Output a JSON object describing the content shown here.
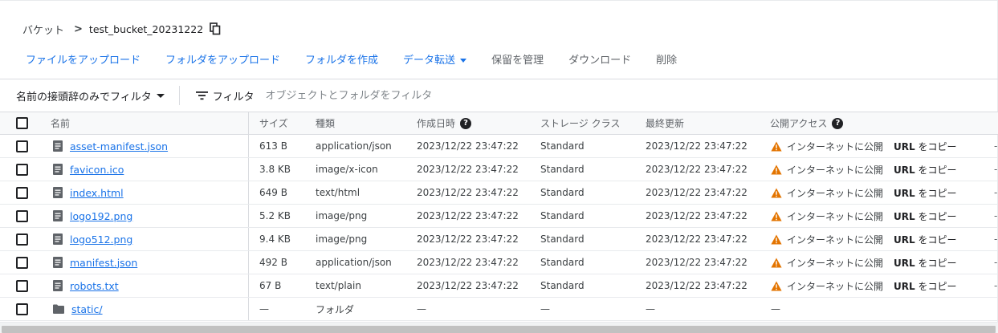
{
  "breadcrumb": {
    "root": "バケット",
    "separator": ">",
    "current": "test_bucket_20231222"
  },
  "toolbar": {
    "upload_files": "ファイルをアップロード",
    "upload_folder": "フォルダをアップロード",
    "create_folder": "フォルダを作成",
    "transfer_data": "データ転送",
    "manage_holds": "保留を管理",
    "download": "ダウンロード",
    "delete": "削除"
  },
  "filter_bar": {
    "prefix_filter": "名前の接頭辞のみでフィルタ",
    "filter_label": "フィルタ",
    "filter_placeholder": "オブジェクトとフォルダをフィルタ"
  },
  "columns": {
    "name": "名前",
    "size": "サイズ",
    "type": "種類",
    "created": "作成日時",
    "storage_class": "ストレージ クラス",
    "updated": "最終更新",
    "public_access": "公開アクセス"
  },
  "rows": [
    {
      "name": "asset-manifest.json",
      "size": "613 B",
      "type": "application/json",
      "created": "2023/12/22 23:47:22",
      "storage_class": "Standard",
      "updated": "2023/12/22 23:47:22",
      "public_access": "インターネットに公開",
      "copy_url_bold": "URL",
      "copy_url_rest": " をコピー",
      "icon": "file-icon",
      "trail": "-"
    },
    {
      "name": "favicon.ico",
      "size": "3.8 KB",
      "type": "image/x-icon",
      "created": "2023/12/22 23:47:22",
      "storage_class": "Standard",
      "updated": "2023/12/22 23:47:22",
      "public_access": "インターネットに公開",
      "copy_url_bold": "URL",
      "copy_url_rest": " をコピー",
      "icon": "file-icon",
      "trail": "-"
    },
    {
      "name": "index.html",
      "size": "649 B",
      "type": "text/html",
      "created": "2023/12/22 23:47:22",
      "storage_class": "Standard",
      "updated": "2023/12/22 23:47:22",
      "public_access": "インターネットに公開",
      "copy_url_bold": "URL",
      "copy_url_rest": " をコピー",
      "icon": "file-icon",
      "trail": "-"
    },
    {
      "name": "logo192.png",
      "size": "5.2 KB",
      "type": "image/png",
      "created": "2023/12/22 23:47:22",
      "storage_class": "Standard",
      "updated": "2023/12/22 23:47:22",
      "public_access": "インターネットに公開",
      "copy_url_bold": "URL",
      "copy_url_rest": " をコピー",
      "icon": "file-icon",
      "trail": "-"
    },
    {
      "name": "logo512.png",
      "size": "9.4 KB",
      "type": "image/png",
      "created": "2023/12/22 23:47:22",
      "storage_class": "Standard",
      "updated": "2023/12/22 23:47:22",
      "public_access": "インターネットに公開",
      "copy_url_bold": "URL",
      "copy_url_rest": " をコピー",
      "icon": "file-icon",
      "trail": "-"
    },
    {
      "name": "manifest.json",
      "size": "492 B",
      "type": "application/json",
      "created": "2023/12/22 23:47:22",
      "storage_class": "Standard",
      "updated": "2023/12/22 23:47:22",
      "public_access": "インターネットに公開",
      "copy_url_bold": "URL",
      "copy_url_rest": " をコピー",
      "icon": "file-icon",
      "trail": "-"
    },
    {
      "name": "robots.txt",
      "size": "67 B",
      "type": "text/plain",
      "created": "2023/12/22 23:47:22",
      "storage_class": "Standard",
      "updated": "2023/12/22 23:47:22",
      "public_access": "インターネットに公開",
      "copy_url_bold": "URL",
      "copy_url_rest": " をコピー",
      "icon": "file-icon",
      "trail": "-"
    },
    {
      "name": "static/",
      "size": "—",
      "type": "フォルダ",
      "created": "—",
      "storage_class": "—",
      "updated": "—",
      "public_access": "—",
      "copy_url_bold": "",
      "copy_url_rest": "",
      "icon": "folder-icon",
      "trail": ""
    }
  ],
  "colors": {
    "link": "#1a73e8",
    "warning": "#e37400",
    "text": "#202124",
    "muted": "#5f6368"
  }
}
